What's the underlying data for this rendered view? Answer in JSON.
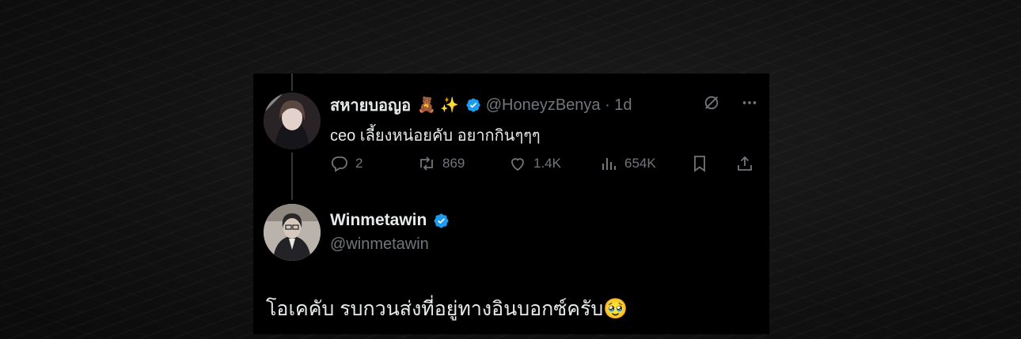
{
  "reply": {
    "display_name": "สหายบอญอ",
    "name_emojis": "🧸 ✨",
    "handle_time": "@HoneyzBenya · 1d",
    "text": "ceo เลี้ยงหน่อยคับ อยากกินๆๆๆ",
    "stats": {
      "replies": "2",
      "reposts": "869",
      "likes": "1.4K",
      "views": "654K"
    }
  },
  "post": {
    "display_name": "Winmetawin",
    "handle": "@winmetawin",
    "text": "โอเคคับ รบกวนส่งที่อยู่ทางอินบอกซ์ครับ🥹"
  },
  "colors": {
    "verified": "#1d9bf0",
    "muted": "#71767b",
    "text": "#e7e9ea"
  },
  "icons": [
    "verified-badge-icon",
    "grok-icon",
    "more-icon",
    "reply-icon",
    "repost-icon",
    "like-icon",
    "views-icon",
    "bookmark-icon",
    "share-icon"
  ]
}
